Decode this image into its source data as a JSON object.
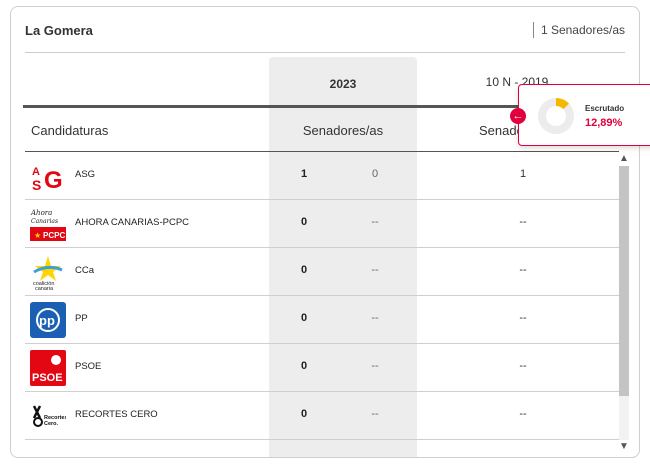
{
  "card": {
    "title": "La Gomera",
    "seats": "1 Senadores/as"
  },
  "columns": {
    "year_current": "2023",
    "year_previous": "10 N - 2019",
    "candidaturas": "Candidaturas",
    "senadores_current": "Senadores/as",
    "senadores_previous": "Senadores/as"
  },
  "popup": {
    "label": "Escrutado",
    "value": "12,89%",
    "progress_fraction": 0.1289,
    "accent_color": "#f5b800"
  },
  "parties": [
    {
      "name": "ASG",
      "logo": "asg-logo",
      "v2023": "1",
      "diff": "0",
      "v2019": "1"
    },
    {
      "name": "AHORA CANARIAS-PCPC",
      "logo": "ahora-canarias-pcpc-logo",
      "v2023": "0",
      "diff": "--",
      "v2019": "--"
    },
    {
      "name": "CCa",
      "logo": "coalicion-canaria-logo",
      "v2023": "0",
      "diff": "--",
      "v2019": "--"
    },
    {
      "name": "PP",
      "logo": "pp-logo",
      "v2023": "0",
      "diff": "--",
      "v2019": "--"
    },
    {
      "name": "PSOE",
      "logo": "psoe-logo",
      "v2023": "0",
      "diff": "--",
      "v2019": "--"
    },
    {
      "name": "RECORTES CERO",
      "logo": "recortes-cero-logo",
      "v2023": "0",
      "diff": "--",
      "v2019": "--"
    }
  ],
  "logo_text": {
    "asg": "ASG",
    "ahora": "Ahora Canarias",
    "pcpc": "PCPC",
    "cca": "coalición canaria",
    "pp": "PP",
    "psoe": "PSOE",
    "recortes": "Recortes Cero."
  },
  "colors": {
    "accent": "#e0003c",
    "pp_blue": "#1a5fb4",
    "psoe_red": "#e30613"
  }
}
